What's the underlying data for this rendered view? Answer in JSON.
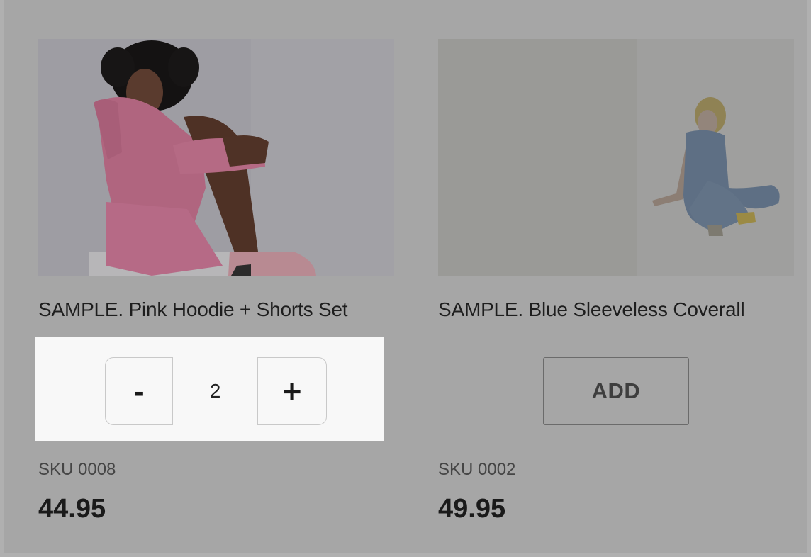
{
  "products": [
    {
      "title": "SAMPLE. Pink Hoodie + Shorts Set",
      "sku": "SKU 0008",
      "price": "44.95",
      "quantity": "2",
      "minus_label": "-",
      "plus_label": "+"
    },
    {
      "title": "SAMPLE. Blue Sleeveless Coverall",
      "sku": "SKU 0002",
      "price": "49.95",
      "add_label": "ADD"
    }
  ],
  "colors": {
    "overlay": "#a6a6a6",
    "highlight_panel": "#f8f8f8",
    "text_dark": "#1a1a1a"
  }
}
